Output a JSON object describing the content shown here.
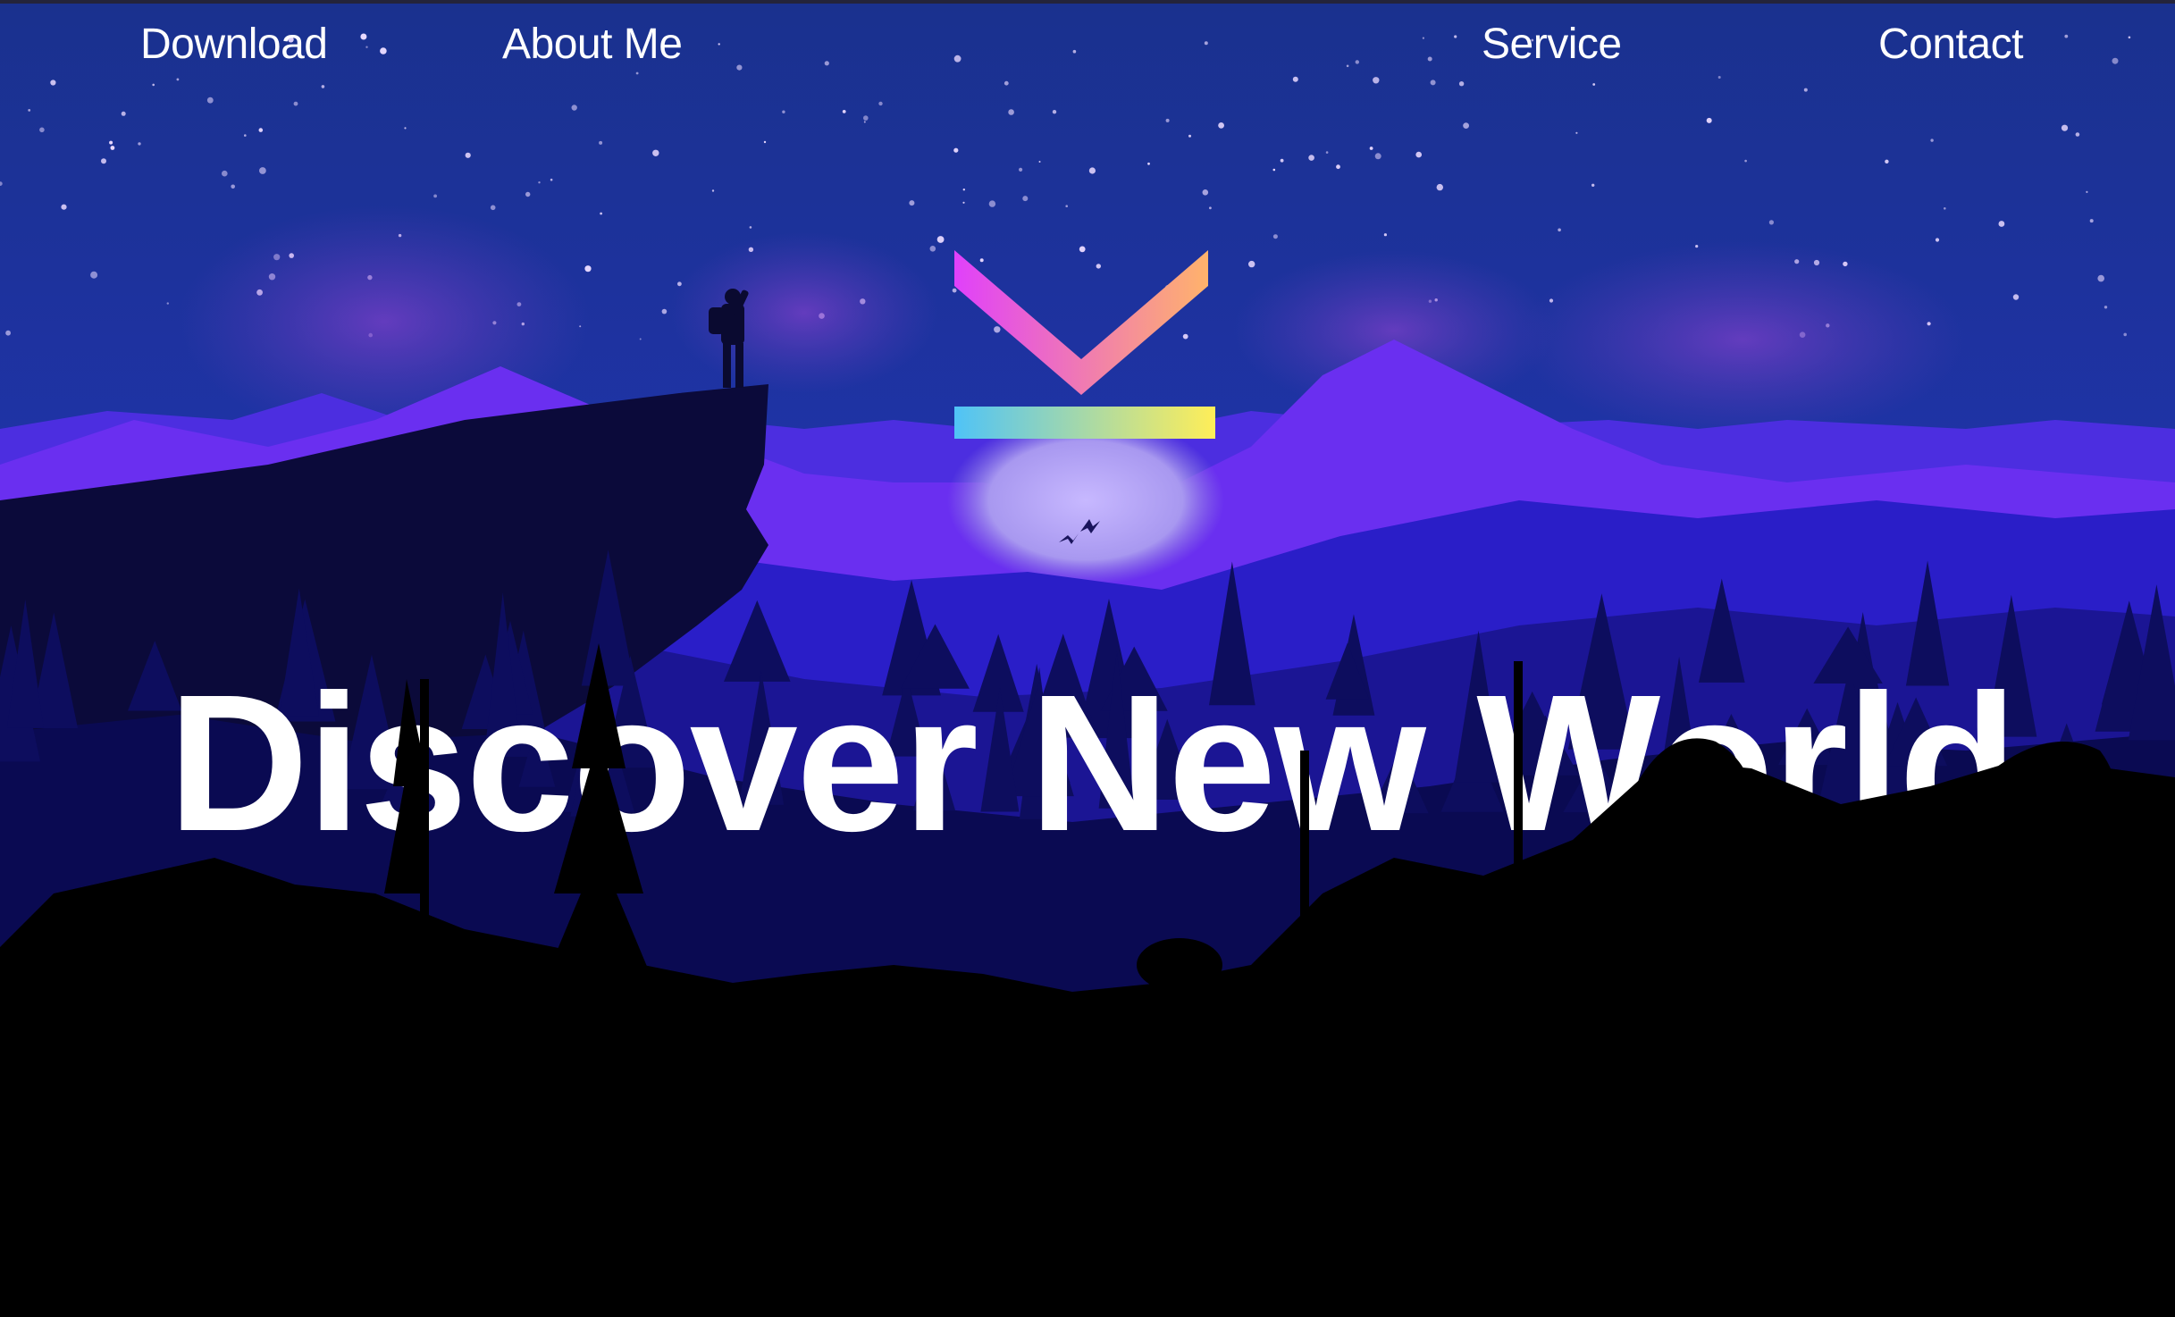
{
  "nav": {
    "items": [
      {
        "label": "Download"
      },
      {
        "label": "About Me"
      },
      {
        "label": "Service"
      },
      {
        "label": "Contact"
      }
    ]
  },
  "hero": {
    "title": "Discover New World"
  },
  "colors": {
    "sky_top": "#1a2f8c",
    "sky_bottom": "#3a1fb8",
    "mountain_purple": "#6a2ff0",
    "logo_gradient_magenta": "#e040fb",
    "logo_gradient_orange": "#ffb36b",
    "logo_bar_blue": "#4fc3f7",
    "logo_bar_yellow": "#ffee58"
  },
  "icons": {
    "logo": "brand-logo-icon",
    "hiker": "hiker-silhouette-icon",
    "birds": "birds-icon"
  }
}
